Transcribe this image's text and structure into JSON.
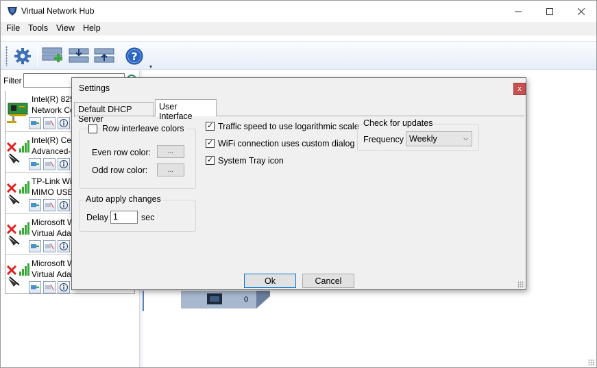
{
  "app": {
    "title": "Virtual Network Hub"
  },
  "window_controls": {
    "minimize": "—",
    "maximize": "☐",
    "close": "✕"
  },
  "menu": [
    "File",
    "Tools",
    "View",
    "Help"
  ],
  "toolbar": {
    "buttons": [
      "settings-icon",
      "add-adapter-icon",
      "import-icon",
      "export-icon",
      "help-icon"
    ],
    "overflow": "▾"
  },
  "left_panel": {
    "filter_label": "Filter",
    "filter_value": "",
    "adapters": [
      {
        "line1": "Intel(R) 825",
        "line2": "Network Co",
        "type": "wired"
      },
      {
        "line1": "Intel(R) Cen",
        "line2": "Advanced-N",
        "type": "wifi-disconnected"
      },
      {
        "line1": "TP-Link Wir",
        "line2": "MIMO USB",
        "type": "wifi-disconnected"
      },
      {
        "line1": "Microsoft W",
        "line2": "Virtual Ada",
        "type": "wifi-disconnected"
      },
      {
        "line1": "Microsoft W",
        "line2": "Virtual Ada",
        "type": "wifi-disconnected"
      }
    ]
  },
  "canvas": {
    "hub_count": "0"
  },
  "dialog": {
    "title": "Settings",
    "close": "x",
    "tabs": [
      "Default DHCP Server",
      "User Interface"
    ],
    "active_tab": "User Interface",
    "row_interleave": {
      "label": "Row interleave colors",
      "checked": false
    },
    "even_row": {
      "label": "Even row color:",
      "button": "..."
    },
    "odd_row": {
      "label": "Odd row color:",
      "button": "..."
    },
    "auto_apply": {
      "legend": "Auto apply changes",
      "delay_label": "Delay",
      "delay_value": "1",
      "unit": "sec"
    },
    "options": [
      {
        "label": "Traffic speed to use logarithmic scale",
        "checked": true
      },
      {
        "label": "WiFi connection uses custom dialog",
        "checked": true
      },
      {
        "label": "System Tray icon",
        "checked": true
      }
    ],
    "updates": {
      "legend": "Check for updates",
      "frequency_label": "Frequency",
      "frequency_value": "Weekly"
    },
    "ok": "Ok",
    "cancel": "Cancel"
  }
}
